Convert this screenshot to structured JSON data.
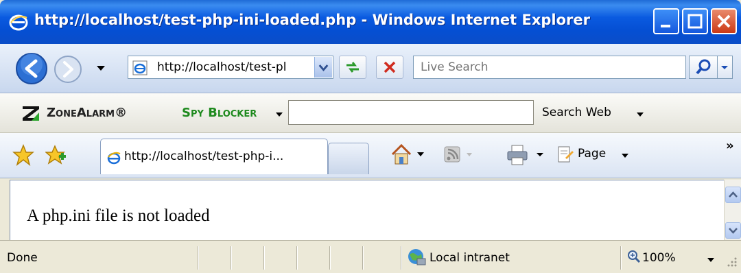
{
  "window": {
    "title": "http://localhost/test-php-ini-loaded.php - Windows Internet Explorer",
    "title_icon": "ie-logo-icon",
    "buttons": [
      "minimize-icon",
      "maximize-icon",
      "close-icon"
    ]
  },
  "nav": {
    "address_value": "http://localhost/test-pl",
    "search_placeholder": "Live Search"
  },
  "zonealarm": {
    "brand": "ZoneAlarm®",
    "product": "Spy Blocker",
    "search_web_label": "Search Web"
  },
  "tabs": {
    "active_label": "http://localhost/test-php-i...",
    "commands": {
      "page_label": "Page",
      "more": "»"
    }
  },
  "content": {
    "text": "A php.ini file is not loaded"
  },
  "status": {
    "text": "Done",
    "zone": "Local intranet",
    "zoom": "100%"
  },
  "colors": {
    "titlebar": "#0a5ae0",
    "chrome": "#ece9d8",
    "product_green": "#1e8a1e"
  }
}
